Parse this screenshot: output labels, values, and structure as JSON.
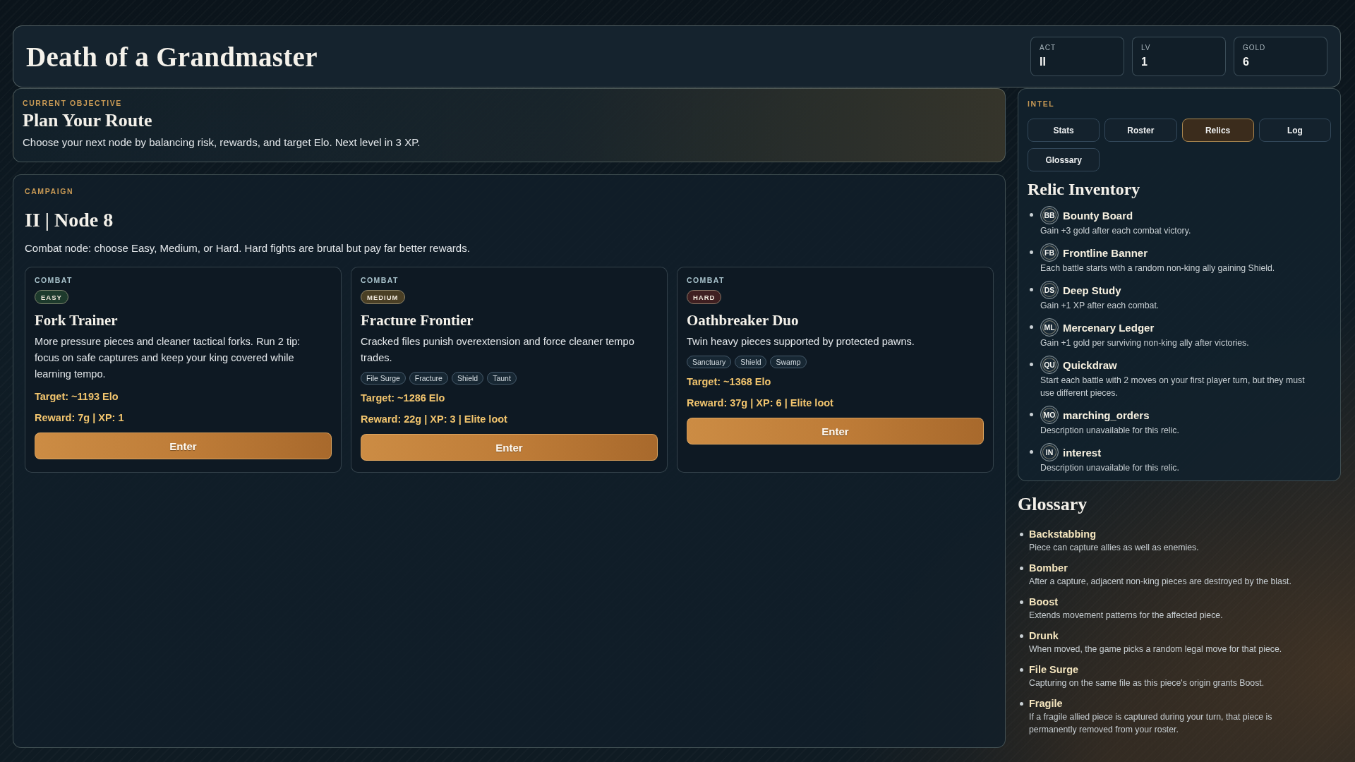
{
  "header": {
    "title": "Death of a Grandmaster",
    "stats": [
      {
        "label": "ACT",
        "value": "II"
      },
      {
        "label": "LV",
        "value": "1"
      },
      {
        "label": "GOLD",
        "value": "6"
      }
    ]
  },
  "objective": {
    "label": "CURRENT OBJECTIVE",
    "title": "Plan Your Route",
    "text": "Choose your next node by balancing risk, rewards, and target Elo. Next level in 3 XP."
  },
  "campaign": {
    "label": "CAMPAIGN",
    "title": "II | Node 8",
    "text": "Combat node: choose Easy, Medium, or Hard. Hard fights are brutal but pay far better rewards.",
    "nodes": [
      {
        "category": "COMBAT",
        "difficulty": {
          "label": "EASY",
          "color": "#1d3a2c"
        },
        "title": "Fork Trainer",
        "description": "More pressure pieces and cleaner tactical forks. Run 2 tip: focus on safe captures and keep your king covered while learning tempo.",
        "target": "Target: ~1193 Elo",
        "reward": "Reward: 7g | XP: 1",
        "button": "Enter"
      },
      {
        "category": "COMBAT",
        "difficulty": {
          "label": "MEDIUM",
          "color": "#4a3f25"
        },
        "title": "Fracture Frontier",
        "description": "Cracked files punish overextension and force cleaner tempo trades.",
        "tags": [
          "File Surge",
          "Fracture",
          "Shield",
          "Taunt"
        ],
        "target": "Target: ~1286 Elo",
        "reward": "Reward: 22g | XP: 3 | Elite loot",
        "button": "Enter"
      },
      {
        "category": "COMBAT",
        "difficulty": {
          "label": "HARD",
          "color": "#3f1f21"
        },
        "title": "Oathbreaker Duo",
        "description": "Twin heavy pieces supported by protected pawns.",
        "tags": [
          "Sanctuary",
          "Shield",
          "Swamp"
        ],
        "target": "Target: ~1368 Elo",
        "reward": "Reward: 37g | XP: 6 | Elite loot",
        "button": "Enter"
      }
    ]
  },
  "intel": {
    "label": "INTEL",
    "tabs": [
      {
        "label": "Stats",
        "selected": false
      },
      {
        "label": "Roster",
        "selected": false
      },
      {
        "label": "Relics",
        "selected": true
      },
      {
        "label": "Log",
        "selected": false
      },
      {
        "label": "Glossary",
        "selected": false
      }
    ],
    "heading": "Relic Inventory",
    "relics": [
      {
        "initials": "BB",
        "name": "Bounty Board",
        "description": "Gain +3 gold after each combat victory."
      },
      {
        "initials": "FB",
        "name": "Frontline Banner",
        "description": "Each battle starts with a random non-king ally gaining Shield."
      },
      {
        "initials": "DS",
        "name": "Deep Study",
        "description": "Gain +1 XP after each combat."
      },
      {
        "initials": "ML",
        "name": "Mercenary Ledger",
        "description": "Gain +1 gold per surviving non-king ally after victories."
      },
      {
        "initials": "QU",
        "name": "Quickdraw",
        "description": "Start each battle with 2 moves on your first player turn, but they must use different pieces."
      },
      {
        "initials": "MO",
        "name": "marching_orders",
        "description": "Description unavailable for this relic."
      },
      {
        "initials": "IN",
        "name": "interest",
        "description": "Description unavailable for this relic."
      }
    ]
  },
  "glossary": {
    "heading": "Glossary",
    "terms": [
      {
        "term": "Backstabbing",
        "definition": "Piece can capture allies as well as enemies."
      },
      {
        "term": "Bomber",
        "definition": "After a capture, adjacent non-king pieces are destroyed by the blast."
      },
      {
        "term": "Boost",
        "definition": "Extends movement patterns for the affected piece."
      },
      {
        "term": "Drunk",
        "definition": "When moved, the game picks a random legal move for that piece."
      },
      {
        "term": "File Surge",
        "definition": "Capturing on the same file as this piece's origin grants Boost."
      },
      {
        "term": "Fragile",
        "definition": "If a fragile allied piece is captured during your turn, that piece is permanently removed from your roster."
      }
    ]
  }
}
